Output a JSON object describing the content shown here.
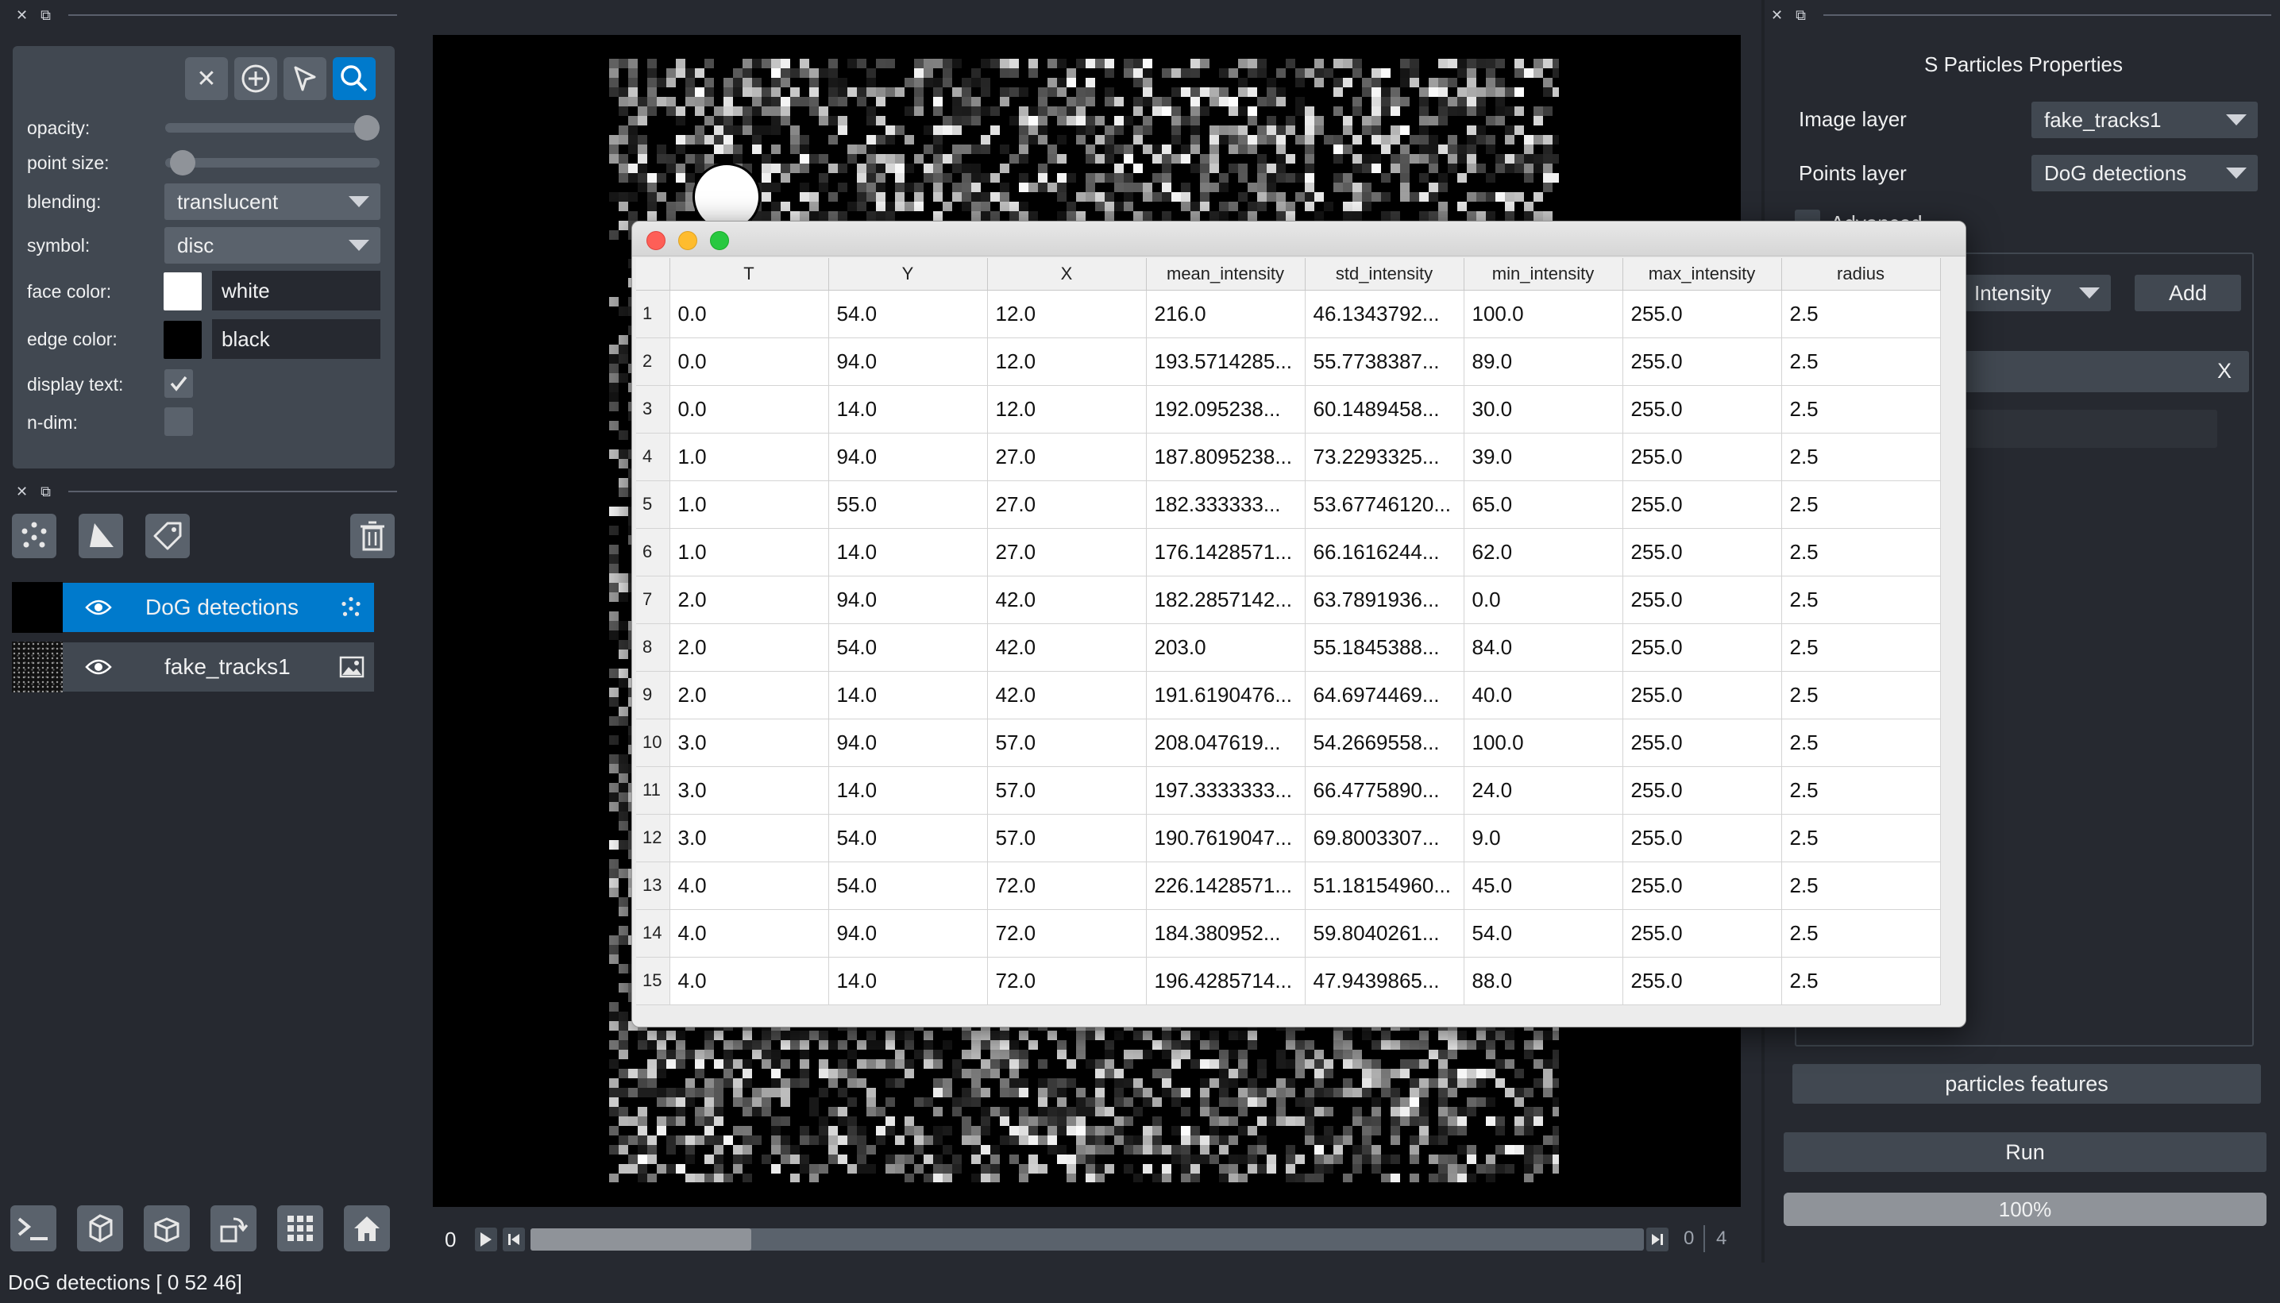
{
  "layer_controls": {
    "opacity_label": "opacity:",
    "opacity_value": 1.0,
    "point_size_label": "point size:",
    "point_size_value": 0.05,
    "blending_label": "blending:",
    "blending_value": "translucent",
    "symbol_label": "symbol:",
    "symbol_value": "disc",
    "face_color_label": "face color:",
    "face_color_value": "white",
    "face_color_hex": "#ffffff",
    "edge_color_label": "edge color:",
    "edge_color_value": "black",
    "edge_color_hex": "#000000",
    "display_text_label": "display text:",
    "display_text_checked": true,
    "ndim_label": "n-dim:",
    "ndim_checked": false,
    "active_tool": "zoom"
  },
  "layers": [
    {
      "name": "DoG detections",
      "selected": true,
      "type_icon": "points-icon"
    },
    {
      "name": "fake_tracks1",
      "selected": false,
      "type_icon": "image-icon"
    }
  ],
  "dims": {
    "current": "0",
    "range_min": "0",
    "range_max": "4"
  },
  "status_bar": "DoG detections [ 0 52 46]",
  "plugin": {
    "title": "S Particles Properties",
    "image_layer_label": "Image layer",
    "image_layer_value": "fake_tracks1",
    "points_layer_label": "Points layer",
    "points_layer_value": "DoG detections",
    "advanced_label": "Advanced",
    "feature_combo_value": "Intensity",
    "add_label": "Add",
    "remove_label": "X",
    "features_button": "particles features",
    "run_button": "Run",
    "progress_text": "100%",
    "progress_value": 1.0
  },
  "table": {
    "columns": [
      "T",
      "Y",
      "X",
      "mean_intensity",
      "std_intensity",
      "min_intensity",
      "max_intensity",
      "radius"
    ],
    "rows": [
      [
        "0.0",
        "54.0",
        "12.0",
        "216.0",
        "46.1343792...",
        "100.0",
        "255.0",
        "2.5"
      ],
      [
        "0.0",
        "94.0",
        "12.0",
        "193.5714285...",
        "55.7738387...",
        "89.0",
        "255.0",
        "2.5"
      ],
      [
        "0.0",
        "14.0",
        "12.0",
        "192.095238...",
        "60.1489458...",
        "30.0",
        "255.0",
        "2.5"
      ],
      [
        "1.0",
        "94.0",
        "27.0",
        "187.8095238...",
        "73.2293325...",
        "39.0",
        "255.0",
        "2.5"
      ],
      [
        "1.0",
        "55.0",
        "27.0",
        "182.333333...",
        "53.67746120...",
        "65.0",
        "255.0",
        "2.5"
      ],
      [
        "1.0",
        "14.0",
        "27.0",
        "176.1428571...",
        "66.1616244...",
        "62.0",
        "255.0",
        "2.5"
      ],
      [
        "2.0",
        "94.0",
        "42.0",
        "182.2857142...",
        "63.7891936...",
        "0.0",
        "255.0",
        "2.5"
      ],
      [
        "2.0",
        "54.0",
        "42.0",
        "203.0",
        "55.1845388...",
        "84.0",
        "255.0",
        "2.5"
      ],
      [
        "2.0",
        "14.0",
        "42.0",
        "191.6190476...",
        "64.6974469...",
        "40.0",
        "255.0",
        "2.5"
      ],
      [
        "3.0",
        "94.0",
        "57.0",
        "208.047619...",
        "54.2669558...",
        "100.0",
        "255.0",
        "2.5"
      ],
      [
        "3.0",
        "14.0",
        "57.0",
        "197.3333333...",
        "66.4775890...",
        "24.0",
        "255.0",
        "2.5"
      ],
      [
        "3.0",
        "54.0",
        "57.0",
        "190.7619047...",
        "69.8003307...",
        "9.0",
        "255.0",
        "2.5"
      ],
      [
        "4.0",
        "54.0",
        "72.0",
        "226.1428571...",
        "51.18154960...",
        "45.0",
        "255.0",
        "2.5"
      ],
      [
        "4.0",
        "94.0",
        "72.0",
        "184.380952...",
        "59.8040261...",
        "54.0",
        "255.0",
        "2.5"
      ],
      [
        "4.0",
        "14.0",
        "72.0",
        "196.4285714...",
        "47.9439865...",
        "88.0",
        "255.0",
        "2.5"
      ]
    ]
  },
  "colors": {
    "accent": "#007acc",
    "background": "#262930",
    "panel": "#414851"
  }
}
